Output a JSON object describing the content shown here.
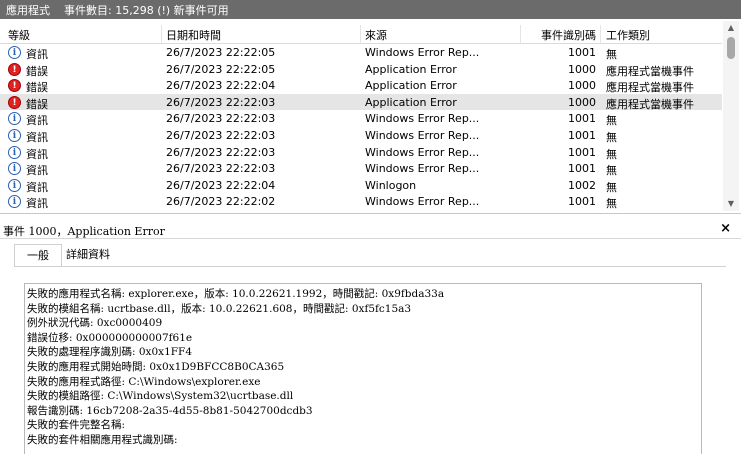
{
  "titlebar": {
    "title": "應用程式",
    "event_count": "事件數目: 15,298 (!) 新事件可用"
  },
  "columns": {
    "level": "等級",
    "date": "日期和時間",
    "source": "來源",
    "event_id": "事件識別碼",
    "task": "工作類別"
  },
  "rows": [
    {
      "level": "資訊",
      "icon": "info-icon",
      "date": "26/7/2023 22:22:05",
      "source": "Windows Error Rep...",
      "event_id": "1001",
      "task": "無"
    },
    {
      "level": "錯誤",
      "icon": "error-icon",
      "date": "26/7/2023 22:22:05",
      "source": "Application Error",
      "event_id": "1000",
      "task": "應用程式當機事件"
    },
    {
      "level": "錯誤",
      "icon": "error-icon",
      "date": "26/7/2023 22:22:04",
      "source": "Application Error",
      "event_id": "1000",
      "task": "應用程式當機事件"
    },
    {
      "level": "錯誤",
      "icon": "error-icon",
      "date": "26/7/2023 22:22:03",
      "source": "Application Error",
      "event_id": "1000",
      "task": "應用程式當機事件",
      "selected": true
    },
    {
      "level": "資訊",
      "icon": "info-icon",
      "date": "26/7/2023 22:22:03",
      "source": "Windows Error Rep...",
      "event_id": "1001",
      "task": "無"
    },
    {
      "level": "資訊",
      "icon": "info-icon",
      "date": "26/7/2023 22:22:03",
      "source": "Windows Error Rep...",
      "event_id": "1001",
      "task": "無"
    },
    {
      "level": "資訊",
      "icon": "info-icon",
      "date": "26/7/2023 22:22:03",
      "source": "Windows Error Rep...",
      "event_id": "1001",
      "task": "無"
    },
    {
      "level": "資訊",
      "icon": "info-icon",
      "date": "26/7/2023 22:22:03",
      "source": "Windows Error Rep...",
      "event_id": "1001",
      "task": "無"
    },
    {
      "level": "資訊",
      "icon": "info-icon",
      "date": "26/7/2023 22:22:04",
      "source": "Winlogon",
      "event_id": "1002",
      "task": "無"
    },
    {
      "level": "資訊",
      "icon": "info-icon",
      "date": "26/7/2023 22:22:02",
      "source": "Windows Error Rep...",
      "event_id": "1001",
      "task": "無"
    }
  ],
  "detail": {
    "title": "事件 1000，Application Error",
    "close": "×",
    "tabs": [
      "一般",
      "詳細資料"
    ],
    "lines": [
      "失敗的應用程式名稱: explorer.exe，版本: 10.0.22621.1992，時間戳記: 0x9fbda33a",
      "失敗的模組名稱: ucrtbase.dll，版本: 10.0.22621.608，時間戳記: 0xf5fc15a3",
      "例外狀況代碼: 0xc0000409",
      "錯誤位移: 0x000000000007f61e",
      "失敗的處理程序識別碼: 0x0x1FF4",
      "失敗的應用程式開始時間: 0x0x1D9BFCC8B0CA365",
      "失敗的應用程式路徑: C:\\Windows\\explorer.exe",
      "失敗的模組路徑: C:\\Windows\\System32\\ucrtbase.dll",
      "報告識別碼: 16cb7208-2a35-4d55-8b81-5042700dcdb3",
      "失敗的套件完整名稱:",
      "失敗的套件相關應用程式識別碼:"
    ]
  },
  "colors": {
    "titlebar_bg": "#6b6b6b",
    "selected_row": "#e5e5e5",
    "error_icon": "#dd2222",
    "info_icon": "#2b5fb3"
  }
}
